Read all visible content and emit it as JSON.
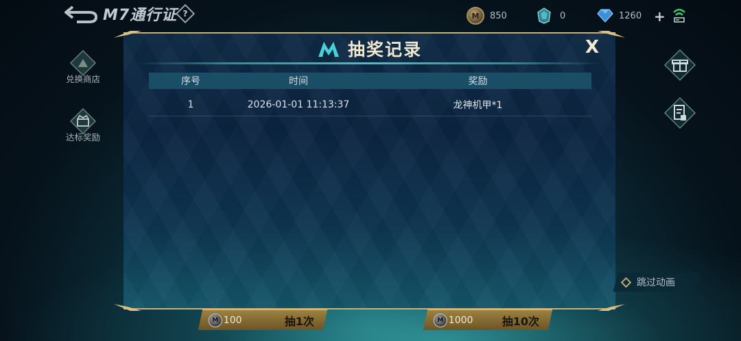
{
  "topbar": {
    "title": "M7通行证",
    "help_label": "?",
    "currencies": [
      {
        "icon": "m-coin-icon",
        "value": "850"
      },
      {
        "icon": "crystal-icon",
        "value": "0"
      },
      {
        "icon": "diamond-icon",
        "value": "1260"
      }
    ],
    "plus_label": "+",
    "coin_letter": "M"
  },
  "sidenav": {
    "items": [
      {
        "label": "兑换商店",
        "icon": "shop-icon"
      },
      {
        "label": "达标奖励",
        "icon": "reward-chest-icon"
      }
    ]
  },
  "dialog": {
    "title": "抽奖记录",
    "close_label": "X",
    "columns": [
      "序号",
      "时间",
      "奖励"
    ],
    "rows": [
      {
        "index": "1",
        "time": "2026-01-01 11:13:37",
        "reward": "龙神机甲*1"
      }
    ]
  },
  "buttons": {
    "single": {
      "cost": "100",
      "label": "抽1次"
    },
    "ten": {
      "cost": "1000",
      "label": "抽10次"
    },
    "skip": {
      "label": "跳过动画"
    }
  },
  "colors": {
    "gold": "#c9b27a",
    "accent_teal": "#4bc0c8",
    "dialog_bg": "#0e2a45"
  }
}
